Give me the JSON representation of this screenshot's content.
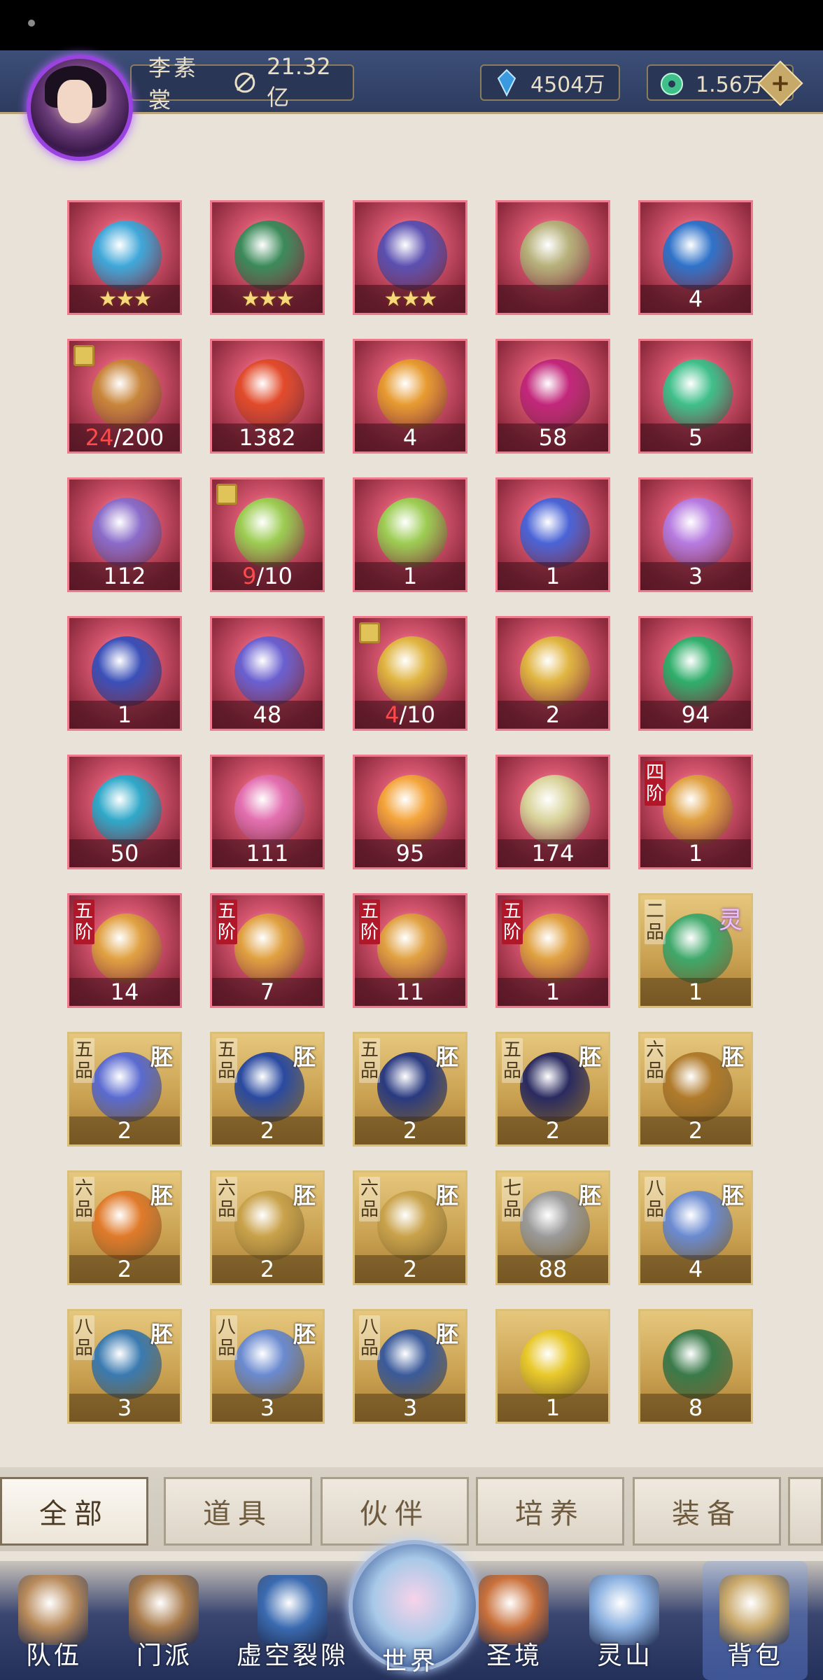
{
  "header": {
    "player_name": "李素裳",
    "combat_power": "21.32亿",
    "currency_crystal": "4504万",
    "currency_jade": "1.56万",
    "add_label": "+"
  },
  "items": [
    {
      "style": "red",
      "icon": "gourd-icon",
      "color": "#3fa7d9",
      "stars": "★★★"
    },
    {
      "style": "red",
      "icon": "cauldron-icon",
      "color": "#3b8a5a",
      "stars": "★★★"
    },
    {
      "style": "red",
      "icon": "mirror-icon",
      "color": "#5a4fb0",
      "stars": "★★★"
    },
    {
      "style": "red",
      "icon": "vase-icon",
      "color": "#b6b07a",
      "stars": ""
    },
    {
      "style": "red",
      "icon": "potion-icon",
      "color": "#2f72c9",
      "count": "4"
    },
    {
      "style": "red",
      "icon": "treasure-chest-icon",
      "color": "#c8853a",
      "puzzle": true,
      "cur": "24",
      "total": "/200"
    },
    {
      "style": "red",
      "icon": "fire-crystal-icon",
      "color": "#e24a2a",
      "count": "1382"
    },
    {
      "style": "red",
      "icon": "amber-orb-icon",
      "color": "#e79a2f",
      "count": "4"
    },
    {
      "style": "red",
      "icon": "magenta-pearl-icon",
      "color": "#c2267a",
      "count": "58"
    },
    {
      "style": "red",
      "icon": "jade-flower-icon",
      "color": "#3fbf8a",
      "count": "5"
    },
    {
      "style": "red",
      "icon": "crystal-shard-icon",
      "color": "#8a6bc9",
      "count": "112"
    },
    {
      "style": "red",
      "icon": "spirit-wisp-icon",
      "color": "#9ccc52",
      "puzzle": true,
      "cur": "9",
      "total": "/10"
    },
    {
      "style": "red",
      "icon": "spirit-wisp-icon",
      "color": "#9ccc52",
      "count": "1"
    },
    {
      "style": "red",
      "icon": "blue-crescent-icon",
      "color": "#4a63d6",
      "count": "1"
    },
    {
      "style": "red",
      "icon": "lotus-pearl-icon",
      "color": "#b67ae0",
      "count": "3"
    },
    {
      "style": "red",
      "icon": "yinyang-orb-icon",
      "color": "#3a4fb8",
      "count": "1"
    },
    {
      "style": "red",
      "icon": "koi-orb-icon",
      "color": "#6a5fd0",
      "count": "48"
    },
    {
      "style": "red",
      "icon": "golden-orb-icon",
      "color": "#e0b440",
      "puzzle": true,
      "cur": "4",
      "total": "/10"
    },
    {
      "style": "red",
      "icon": "golden-orb-icon",
      "color": "#e0b440",
      "count": "2"
    },
    {
      "style": "red",
      "icon": "jade-seal-icon",
      "color": "#2fae6a",
      "count": "94"
    },
    {
      "style": "red",
      "icon": "prism-gem-icon",
      "color": "#2fa8c9",
      "count": "50"
    },
    {
      "style": "red",
      "icon": "ghost-flame-icon",
      "color": "#e36fb0",
      "count": "111"
    },
    {
      "style": "red",
      "icon": "spirit-flame-icon",
      "color": "#f4a43a",
      "count": "95"
    },
    {
      "style": "red",
      "icon": "jade-token-icon",
      "color": "#d9d39a",
      "count": "174"
    },
    {
      "style": "red",
      "icon": "lotus-pill-icon",
      "color": "#e0a040",
      "tier": "四阶",
      "count": "1"
    },
    {
      "style": "red",
      "icon": "lotus-pill-icon",
      "color": "#e0a040",
      "tier": "五阶",
      "count": "14"
    },
    {
      "style": "red",
      "icon": "lotus-pill-icon",
      "color": "#e0a040",
      "tier": "五阶",
      "count": "7"
    },
    {
      "style": "red",
      "icon": "lotus-pill-icon",
      "color": "#e0a040",
      "tier": "五阶",
      "count": "11"
    },
    {
      "style": "red",
      "icon": "lotus-pill-icon",
      "color": "#e0a040",
      "tier": "五阶",
      "count": "1"
    },
    {
      "style": "gold",
      "icon": "jade-beast-icon",
      "color": "#3fa86a",
      "tier": "二品",
      "ling": "灵",
      "count": "1"
    },
    {
      "style": "gold",
      "icon": "sword-icon",
      "color": "#5a6ad0",
      "tier": "五品",
      "pei": "胚",
      "count": "2"
    },
    {
      "style": "gold",
      "icon": "armor-icon",
      "color": "#2a4aa0",
      "tier": "五品",
      "pei": "胚",
      "count": "2"
    },
    {
      "style": "gold",
      "icon": "robe-icon",
      "color": "#2a3a80",
      "tier": "五品",
      "pei": "胚",
      "count": "2"
    },
    {
      "style": "gold",
      "icon": "boots-icon",
      "color": "#2a2a60",
      "tier": "五品",
      "pei": "胚",
      "count": "2"
    },
    {
      "style": "gold",
      "icon": "spear-icon",
      "color": "#b07a2a",
      "tier": "六品",
      "pei": "胚",
      "count": "2"
    },
    {
      "style": "gold",
      "icon": "crown-icon",
      "color": "#e07a2a",
      "tier": "六品",
      "pei": "胚",
      "count": "2"
    },
    {
      "style": "gold",
      "icon": "robe-icon",
      "color": "#c9a24a",
      "tier": "六品",
      "pei": "胚",
      "count": "2"
    },
    {
      "style": "gold",
      "icon": "boots-icon",
      "color": "#c9a24a",
      "tier": "六品",
      "pei": "胚",
      "count": "2"
    },
    {
      "style": "gold",
      "icon": "blade-icon",
      "color": "#9a9a9a",
      "tier": "七品",
      "pei": "胚",
      "count": "88"
    },
    {
      "style": "gold",
      "icon": "curved-blade-icon",
      "color": "#6a8ad0",
      "tier": "八品",
      "pei": "胚",
      "count": "4"
    },
    {
      "style": "gold",
      "icon": "gauntlet-icon",
      "color": "#3a7ab0",
      "tier": "八品",
      "pei": "胚",
      "count": "3"
    },
    {
      "style": "gold",
      "icon": "armor-icon",
      "color": "#6a8ad0",
      "tier": "八品",
      "pei": "胚",
      "count": "3"
    },
    {
      "style": "gold",
      "icon": "boots-icon",
      "color": "#3a5a9a",
      "tier": "八品",
      "pei": "胚",
      "count": "3"
    },
    {
      "style": "gold",
      "icon": "sand-pile-icon",
      "color": "#e8c82a",
      "count": "1"
    },
    {
      "style": "gold",
      "icon": "disc-icon",
      "color": "#3a7a4a",
      "count": "8"
    }
  ],
  "tabs": [
    {
      "label": "全部",
      "active": true
    },
    {
      "label": "道具"
    },
    {
      "label": "伙伴"
    },
    {
      "label": "培养"
    },
    {
      "label": "装备"
    }
  ],
  "nav": [
    {
      "label": "队伍",
      "icon": "team-icon",
      "color": "#b88a5a"
    },
    {
      "label": "门派",
      "icon": "sect-icon",
      "color": "#a87a4a"
    },
    {
      "label": "虚空裂隙",
      "icon": "rift-icon",
      "color": "#3a6ab0"
    },
    {
      "label": "世界",
      "icon": "world-icon",
      "color": "#a8c9e8"
    },
    {
      "label": "圣境",
      "icon": "holy-realm-icon",
      "color": "#c9703a"
    },
    {
      "label": "灵山",
      "icon": "spirit-mountain-icon",
      "color": "#8ab0e0"
    },
    {
      "label": "背包",
      "icon": "backpack-icon",
      "color": "#c9a86a",
      "active": true
    }
  ]
}
